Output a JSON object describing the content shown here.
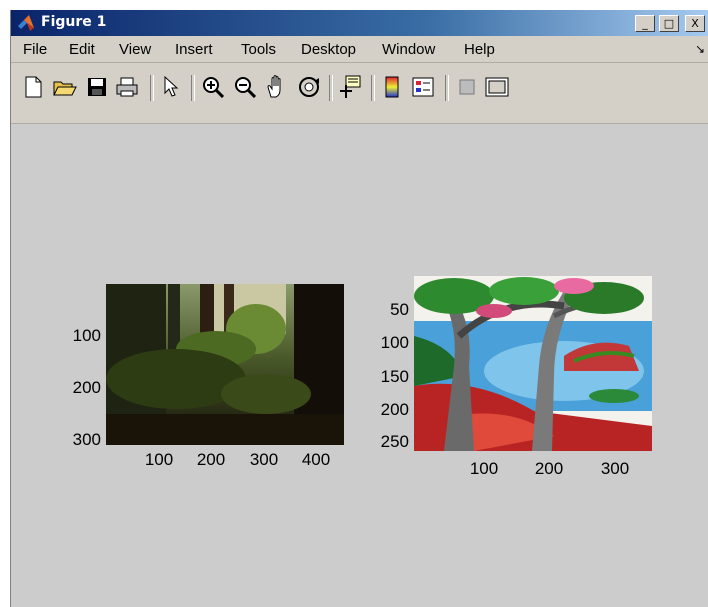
{
  "window": {
    "title": "Figure 1",
    "controls": [
      "_",
      "□",
      "X"
    ]
  },
  "menu": {
    "items": [
      "File",
      "Edit",
      "View",
      "Insert",
      "Tools",
      "Desktop",
      "Window",
      "Help"
    ],
    "overflow_icon": "arrow-icon"
  },
  "toolbar": {
    "buttons": [
      "new-figure-icon",
      "open-file-icon",
      "save-icon",
      "print-icon",
      "edit-plot-icon",
      "zoom-in-icon",
      "zoom-out-icon",
      "pan-icon",
      "rotate-3d-icon",
      "data-cursor-icon",
      "insert-colorbar-icon",
      "insert-legend-icon",
      "hide-plot-tools-icon",
      "show-plot-tools-icon"
    ]
  },
  "axes1": {
    "image": "forest-image",
    "yticks": [
      "100",
      "200",
      "300"
    ],
    "xticks": [
      "100",
      "200",
      "300",
      "400"
    ]
  },
  "axes2": {
    "image": "tree-painting-image",
    "yticks": [
      "50",
      "100",
      "150",
      "200",
      "250"
    ],
    "xticks": [
      "100",
      "200",
      "300"
    ]
  }
}
